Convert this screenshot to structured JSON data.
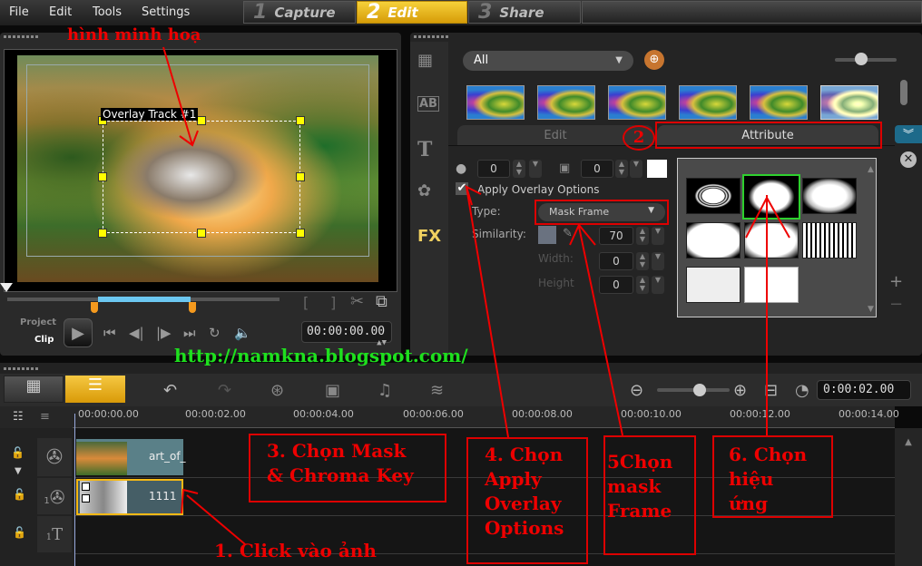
{
  "menu": [
    "File",
    "Edit",
    "Tools",
    "Settings"
  ],
  "steps": [
    {
      "num": "1",
      "label": "Capture",
      "active": false
    },
    {
      "num": "2",
      "label": "Edit",
      "active": true
    },
    {
      "num": "3",
      "label": "Share",
      "active": false
    }
  ],
  "preview": {
    "overlay_label": "Overlay Track #1",
    "project_label": "Project",
    "clip_label": "Clip",
    "timecode": "00:00:00.00"
  },
  "library": {
    "filter": "All",
    "tabs": {
      "edit": "Edit",
      "attribute": "Attribute"
    },
    "thumbnails_count": 6,
    "sidebar": [
      "media-icon",
      "transition-icon",
      "title-icon",
      "graphic-icon",
      "filter-fx-icon"
    ],
    "fx_label": "FX",
    "ab_label": "AB"
  },
  "attributes": {
    "opacity_value": "0",
    "border_value": "0",
    "apply_overlay_label": "Apply Overlay Options",
    "apply_overlay_checked": true,
    "type_label": "Type:",
    "type_value": "Mask Frame",
    "similarity_label": "Similarity:",
    "similarity_value": "70",
    "width_label": "Width:",
    "width_value": "0",
    "height_label": "Height",
    "height_value": "0"
  },
  "masks": [
    "rings",
    "splash",
    "cloud",
    "rough-rect",
    "torn-edge",
    "streaks",
    "grain",
    "puzzle"
  ],
  "timeline": {
    "current_time": "0:00:02.00",
    "ruler": [
      "00:00:00.00",
      "00:00:02.00",
      "00:00:04.00",
      "00:00:06.00",
      "00:00:08.00",
      "00:00:10.00",
      "00:00:12.00",
      "00:00:14.00"
    ],
    "track_add": "+/− ▾",
    "clips": [
      {
        "name": "art_of_",
        "track": "video"
      },
      {
        "name": "1111",
        "track": "overlay"
      }
    ],
    "overlay_track_num": "1",
    "title_track_num": "1"
  },
  "annotations": {
    "caption": "hình minh hoạ",
    "step1": "1. Click vào ảnh",
    "step2": "2",
    "step3": "3. Chọn Mask & Chroma Key",
    "step4": "4. Chọn Apply Overlay Options",
    "step5": "5Chọn mask Frame",
    "step6": "6. Chọn hiệu ứng",
    "watermark": "http://namkna.blogspot.com/"
  },
  "colors": {
    "accent": "#f5b915",
    "annotation": "#e00000",
    "watermark": "#1ee01e",
    "selection": "#2ed02e"
  }
}
